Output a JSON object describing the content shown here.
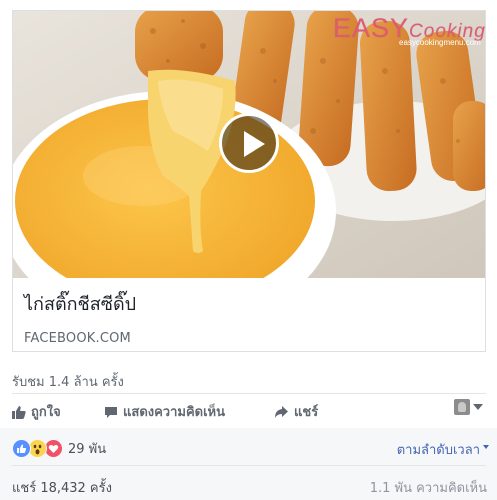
{
  "post": {
    "link_title": "ไก่สติ๊กชีสซีดิ๊ป",
    "link_domain": "FACEBOOK.COM",
    "views": "รับชม 1.4 ล้าน ครั้ง",
    "brand_logo": {
      "easy": "EASY",
      "cooking": "Cooking",
      "url": "easycookingmenu.com"
    }
  },
  "actions": {
    "like": "ถูกใจ",
    "comment": "แสดงความคิดเห็น",
    "share": "แชร์"
  },
  "icons": {
    "play": "play-icon",
    "like": "thumbs-up-icon",
    "comment": "speech-bubble-icon",
    "share": "share-arrow-icon",
    "reactions": [
      "like-reaction-icon",
      "wow-reaction-icon",
      "love-reaction-icon"
    ]
  },
  "reactions": {
    "count": "29 พัน"
  },
  "sort": {
    "label": "ตามลำดับเวลา"
  },
  "stats": {
    "shares": "แชร์ 18,432 ครั้ง",
    "comments": "1.1 พัน ความคิดเห็น"
  },
  "colors": {
    "link_blue": "#4267b2",
    "like_blue": "#5890ff",
    "love_red": "#f25268",
    "wow_yellow": "#fcd44f",
    "muted_text": "#606770"
  }
}
